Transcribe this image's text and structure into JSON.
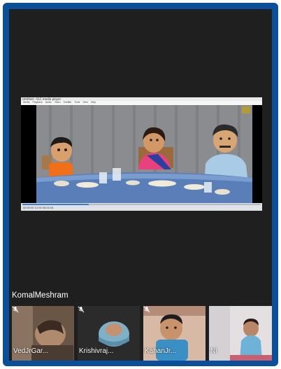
{
  "window": {
    "title": "Untitled - VLC media player",
    "menu": [
      "Media",
      "Playback",
      "Audio",
      "Video",
      "Subtitle",
      "Tools",
      "View",
      "Help"
    ]
  },
  "player": {
    "progress": 0.28,
    "time_text": "00:00:00   12:00   00:01:04"
  },
  "presenter": {
    "name": "KomalMeshram"
  },
  "participants": [
    {
      "name": "VedJrGar...",
      "muted": true
    },
    {
      "name": "Krishivraj...",
      "muted": true
    },
    {
      "name": "KahanJr...",
      "muted": true
    },
    {
      "name": "Ni",
      "muted": true
    }
  ],
  "colors": {
    "frame": "#0b4f9a",
    "screen": "#1f1f1f",
    "progress": "#3b7ad3"
  }
}
